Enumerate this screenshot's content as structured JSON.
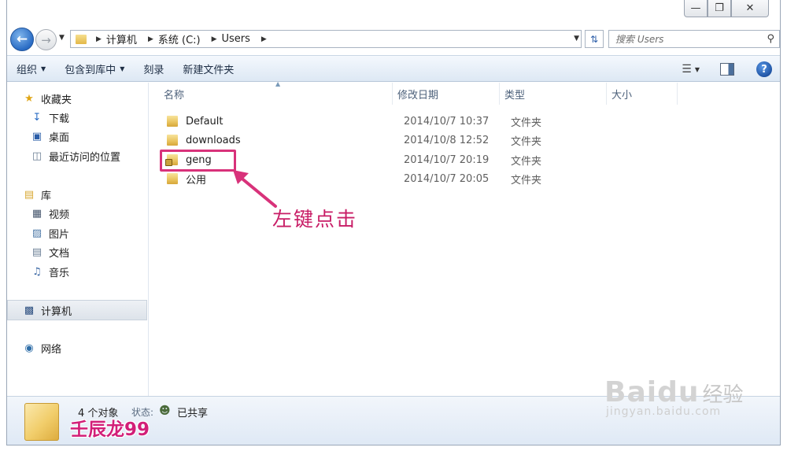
{
  "address": {
    "crumbs": [
      "计算机",
      "系统 (C:)",
      "Users"
    ],
    "search_placeholder": "搜索 Users"
  },
  "toolbar": {
    "organize": "组织",
    "include_library": "包含到库中",
    "burn": "刻录",
    "new_folder": "新建文件夹"
  },
  "sidebar": {
    "favorites": {
      "title": "收藏夹",
      "items": [
        "下载",
        "桌面",
        "最近访问的位置"
      ]
    },
    "libraries": {
      "title": "库",
      "items": [
        "视频",
        "图片",
        "文档",
        "音乐"
      ]
    },
    "computer": "计算机",
    "network": "网络"
  },
  "columns": {
    "name": "名称",
    "modified": "修改日期",
    "type": "类型",
    "size": "大小"
  },
  "files": [
    {
      "name": "Default",
      "modified": "2014/10/7 10:37",
      "type": "文件夹",
      "icon": "folder-icon"
    },
    {
      "name": "downloads",
      "modified": "2014/10/8 12:52",
      "type": "文件夹",
      "icon": "folder-icon"
    },
    {
      "name": "geng",
      "modified": "2014/10/7 20:19",
      "type": "文件夹",
      "icon": "locked-folder-icon"
    },
    {
      "name": "公用",
      "modified": "2014/10/7 20:05",
      "type": "文件夹",
      "icon": "folder-icon"
    }
  ],
  "annotation": "左键点击",
  "status": {
    "count": "4 个对象",
    "state_label": "状态:",
    "shared": "已共享"
  },
  "watermark": {
    "user": "壬辰龙99",
    "baidu_logo": "Baidu",
    "baidu_cn": "经验",
    "baidu_url": "jingyan.baidu.com"
  },
  "colors": {
    "accent": "#d8327a",
    "annotation": "#c81d66",
    "toolbar_bg": "#dde8f4"
  }
}
